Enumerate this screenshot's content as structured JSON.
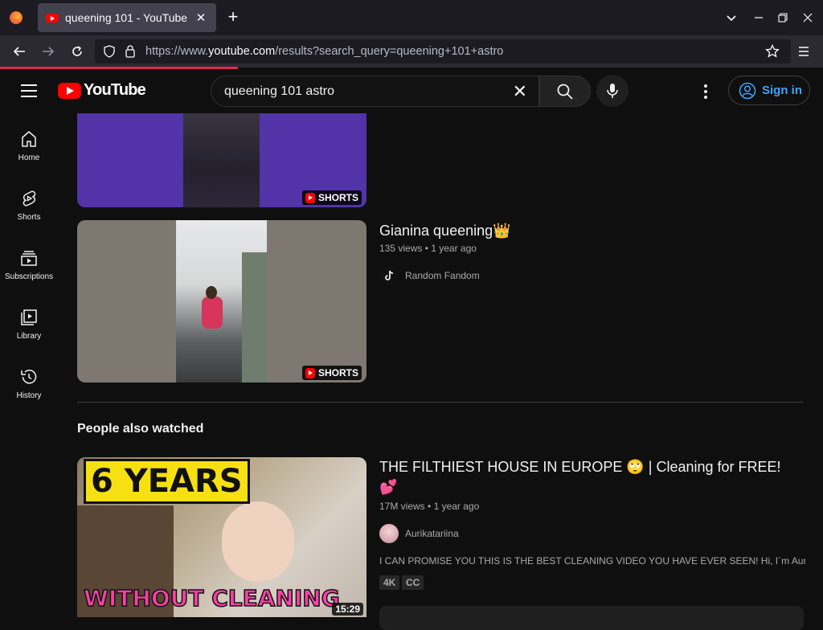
{
  "browser": {
    "tab_title": "queening 101 - YouTube",
    "url_prefix": "https://www.",
    "url_host": "youtube.com",
    "url_path": "/results?search_query=queening+101+astro"
  },
  "header": {
    "logo_text": "YouTube",
    "search_value": "queening 101 astro",
    "sign_in_label": "Sign in"
  },
  "sidebar": {
    "items": [
      {
        "label": "Home",
        "icon": "home-icon"
      },
      {
        "label": "Shorts",
        "icon": "shorts-icon"
      },
      {
        "label": "Subscriptions",
        "icon": "subscriptions-icon"
      },
      {
        "label": "Library",
        "icon": "library-icon"
      },
      {
        "label": "History",
        "icon": "history-icon"
      }
    ]
  },
  "results": [
    {
      "badge": "SHORTS"
    },
    {
      "title": "Gianina queening👑",
      "views": "135 views",
      "age": "1 year ago",
      "channel": "Random Fandom",
      "badge": "SHORTS"
    }
  ],
  "people_also_watched": {
    "section_title": "People also watched",
    "video": {
      "title": "THE FILTHIEST HOUSE IN EUROPE 🙄 | Cleaning for FREE!",
      "title_emoji_line": "💕",
      "views": "17M views",
      "age": "1 year ago",
      "channel": "Aurikatariina",
      "description": "I CAN PROMISE YOU THIS IS THE BEST CLEANING VIDEO YOU HAVE EVER SEEN! Hi, I´m Aurikata...",
      "chips": [
        "4K",
        "CC"
      ],
      "duration": "15:29",
      "thumb_top_text": "6 YEARS",
      "thumb_bottom_text": "WITHOUT CLEANING"
    }
  },
  "colors": {
    "bg": "#0f0f0f",
    "accent_red": "#ff0000",
    "link_blue": "#3ea6ff",
    "secondary_text": "#aaaaaa"
  }
}
